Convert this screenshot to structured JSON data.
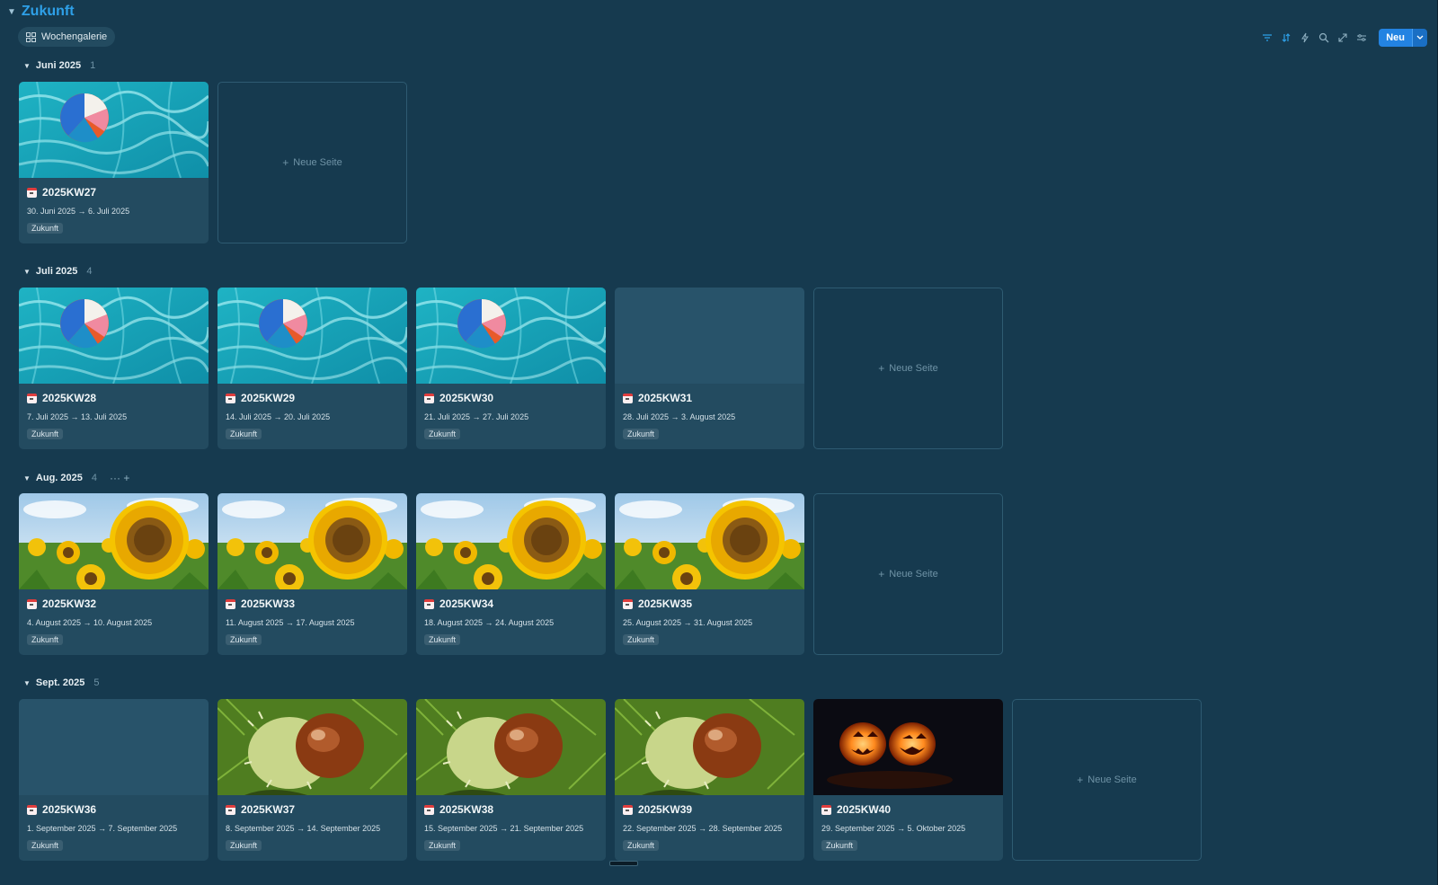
{
  "page": {
    "title": "Zukunft"
  },
  "view": {
    "label": "Wochengalerie",
    "icon": "gallery-grid-icon"
  },
  "toolbar": {
    "icons": [
      "filter-icon",
      "sort-icon",
      "automation-lightning-icon",
      "search-icon",
      "expand-icon",
      "settings-sliders-icon"
    ],
    "new_label": "Neu",
    "accent": "#2383e2"
  },
  "new_page_label": "Neue Seite",
  "groups": [
    {
      "name": "Juni 2025",
      "count": "1",
      "cards": [
        {
          "title": "2025KW27",
          "dates": "30. Juni 2025 → 6. Juli 2025",
          "tag": "Zukunft",
          "cover": "beach-ball-pool"
        }
      ]
    },
    {
      "name": "Juli 2025",
      "count": "4",
      "cards": [
        {
          "title": "2025KW28",
          "dates": "7. Juli 2025 → 13. Juli 2025",
          "tag": "Zukunft",
          "cover": "beach-ball-pool"
        },
        {
          "title": "2025KW29",
          "dates": "14. Juli 2025 → 20. Juli 2025",
          "tag": "Zukunft",
          "cover": "beach-ball-pool"
        },
        {
          "title": "2025KW30",
          "dates": "21. Juli 2025 → 27. Juli 2025",
          "tag": "Zukunft",
          "cover": "beach-ball-pool"
        },
        {
          "title": "2025KW31",
          "dates": "28. Juli 2025 → 3. August 2025",
          "tag": "Zukunft",
          "cover": "none"
        }
      ]
    },
    {
      "name": "Aug. 2025",
      "count": "4",
      "extra": "··· +",
      "cards": [
        {
          "title": "2025KW32",
          "dates": "4. August 2025 → 10. August 2025",
          "tag": "Zukunft",
          "cover": "sunflowers"
        },
        {
          "title": "2025KW33",
          "dates": "11. August 2025 → 17. August 2025",
          "tag": "Zukunft",
          "cover": "sunflowers"
        },
        {
          "title": "2025KW34",
          "dates": "18. August 2025 → 24. August 2025",
          "tag": "Zukunft",
          "cover": "sunflowers"
        },
        {
          "title": "2025KW35",
          "dates": "25. August 2025 → 31. August 2025",
          "tag": "Zukunft",
          "cover": "sunflowers"
        }
      ]
    },
    {
      "name": "Sept. 2025",
      "count": "5",
      "cards": [
        {
          "title": "2025KW36",
          "dates": "1. September 2025 → 7. September 2025",
          "tag": "Zukunft",
          "cover": "none"
        },
        {
          "title": "2025KW37",
          "dates": "8. September 2025 → 14. September 2025",
          "tag": "Zukunft",
          "cover": "chestnut"
        },
        {
          "title": "2025KW38",
          "dates": "15. September 2025 → 21. September 2025",
          "tag": "Zukunft",
          "cover": "chestnut"
        },
        {
          "title": "2025KW39",
          "dates": "22. September 2025 → 28. September 2025",
          "tag": "Zukunft",
          "cover": "chestnut"
        },
        {
          "title": "2025KW40",
          "dates": "29. September 2025 → 5. Oktober 2025",
          "tag": "Zukunft",
          "cover": "pumpkins"
        }
      ]
    }
  ]
}
